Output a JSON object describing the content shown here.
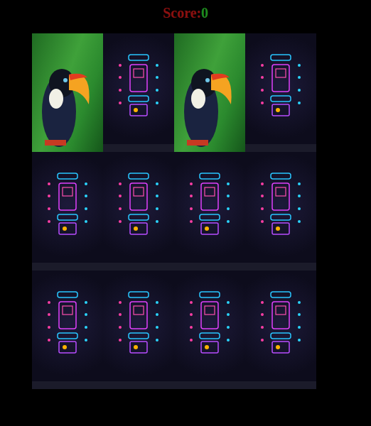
{
  "score": {
    "label": "Score:",
    "value": "0"
  },
  "cards": [
    {
      "face_up": true
    },
    {
      "face_up": false
    },
    {
      "face_up": true
    },
    {
      "face_up": false
    },
    {
      "face_up": false
    },
    {
      "face_up": false
    },
    {
      "face_up": false
    },
    {
      "face_up": false
    },
    {
      "face_up": false
    },
    {
      "face_up": false
    },
    {
      "face_up": false
    },
    {
      "face_up": false
    }
  ]
}
